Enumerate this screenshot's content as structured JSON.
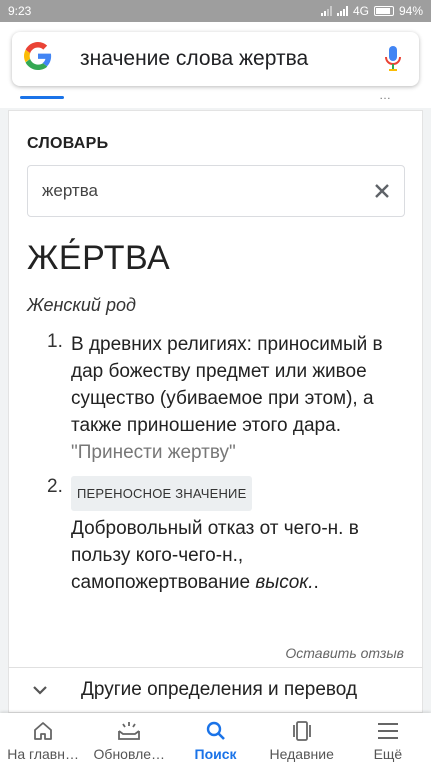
{
  "status_bar": {
    "time": "9:23",
    "network": "4G",
    "battery": "94%"
  },
  "search": {
    "query": "значение слова жертва",
    "logo_letter": "G",
    "mic_icon": "microphone-icon"
  },
  "tabs": {
    "more_glyph": "…"
  },
  "dictionary": {
    "section_label": "СЛОВАРЬ",
    "input_value": "жертва",
    "clear_icon": "close-icon",
    "headword": "ЖЕ́РТВА",
    "part_of_speech": "Женский род",
    "definitions": [
      {
        "number": "1.",
        "text": "В древних религиях: приносимый в дар божеству предмет или живое существо (убиваемое при этом), а также приношение этого дара.",
        "example": "\"Принести жертву\""
      },
      {
        "number": "2.",
        "label": "ПЕРЕНОСНОЕ ЗНАЧЕНИЕ",
        "text": "Добровольный отказ от чего-н. в пользу кого-чего-н., самопожертвование ",
        "note": "высок.",
        "tail": "."
      }
    ],
    "feedback_link": "Оставить отзыв",
    "more_definitions": "Другие определения и перевод"
  },
  "bottom_nav": [
    {
      "label": "На главн…",
      "icon": "home-icon",
      "active": false
    },
    {
      "label": "Обновле…",
      "icon": "updates-icon",
      "active": false
    },
    {
      "label": "Поиск",
      "icon": "search-icon",
      "active": true
    },
    {
      "label": "Недавние",
      "icon": "recent-tabs-icon",
      "active": false
    },
    {
      "label": "Ещё",
      "icon": "menu-icon",
      "active": false
    }
  ],
  "colors": {
    "accent": "#1a73e8",
    "status_bar": "#9e9e9e"
  }
}
